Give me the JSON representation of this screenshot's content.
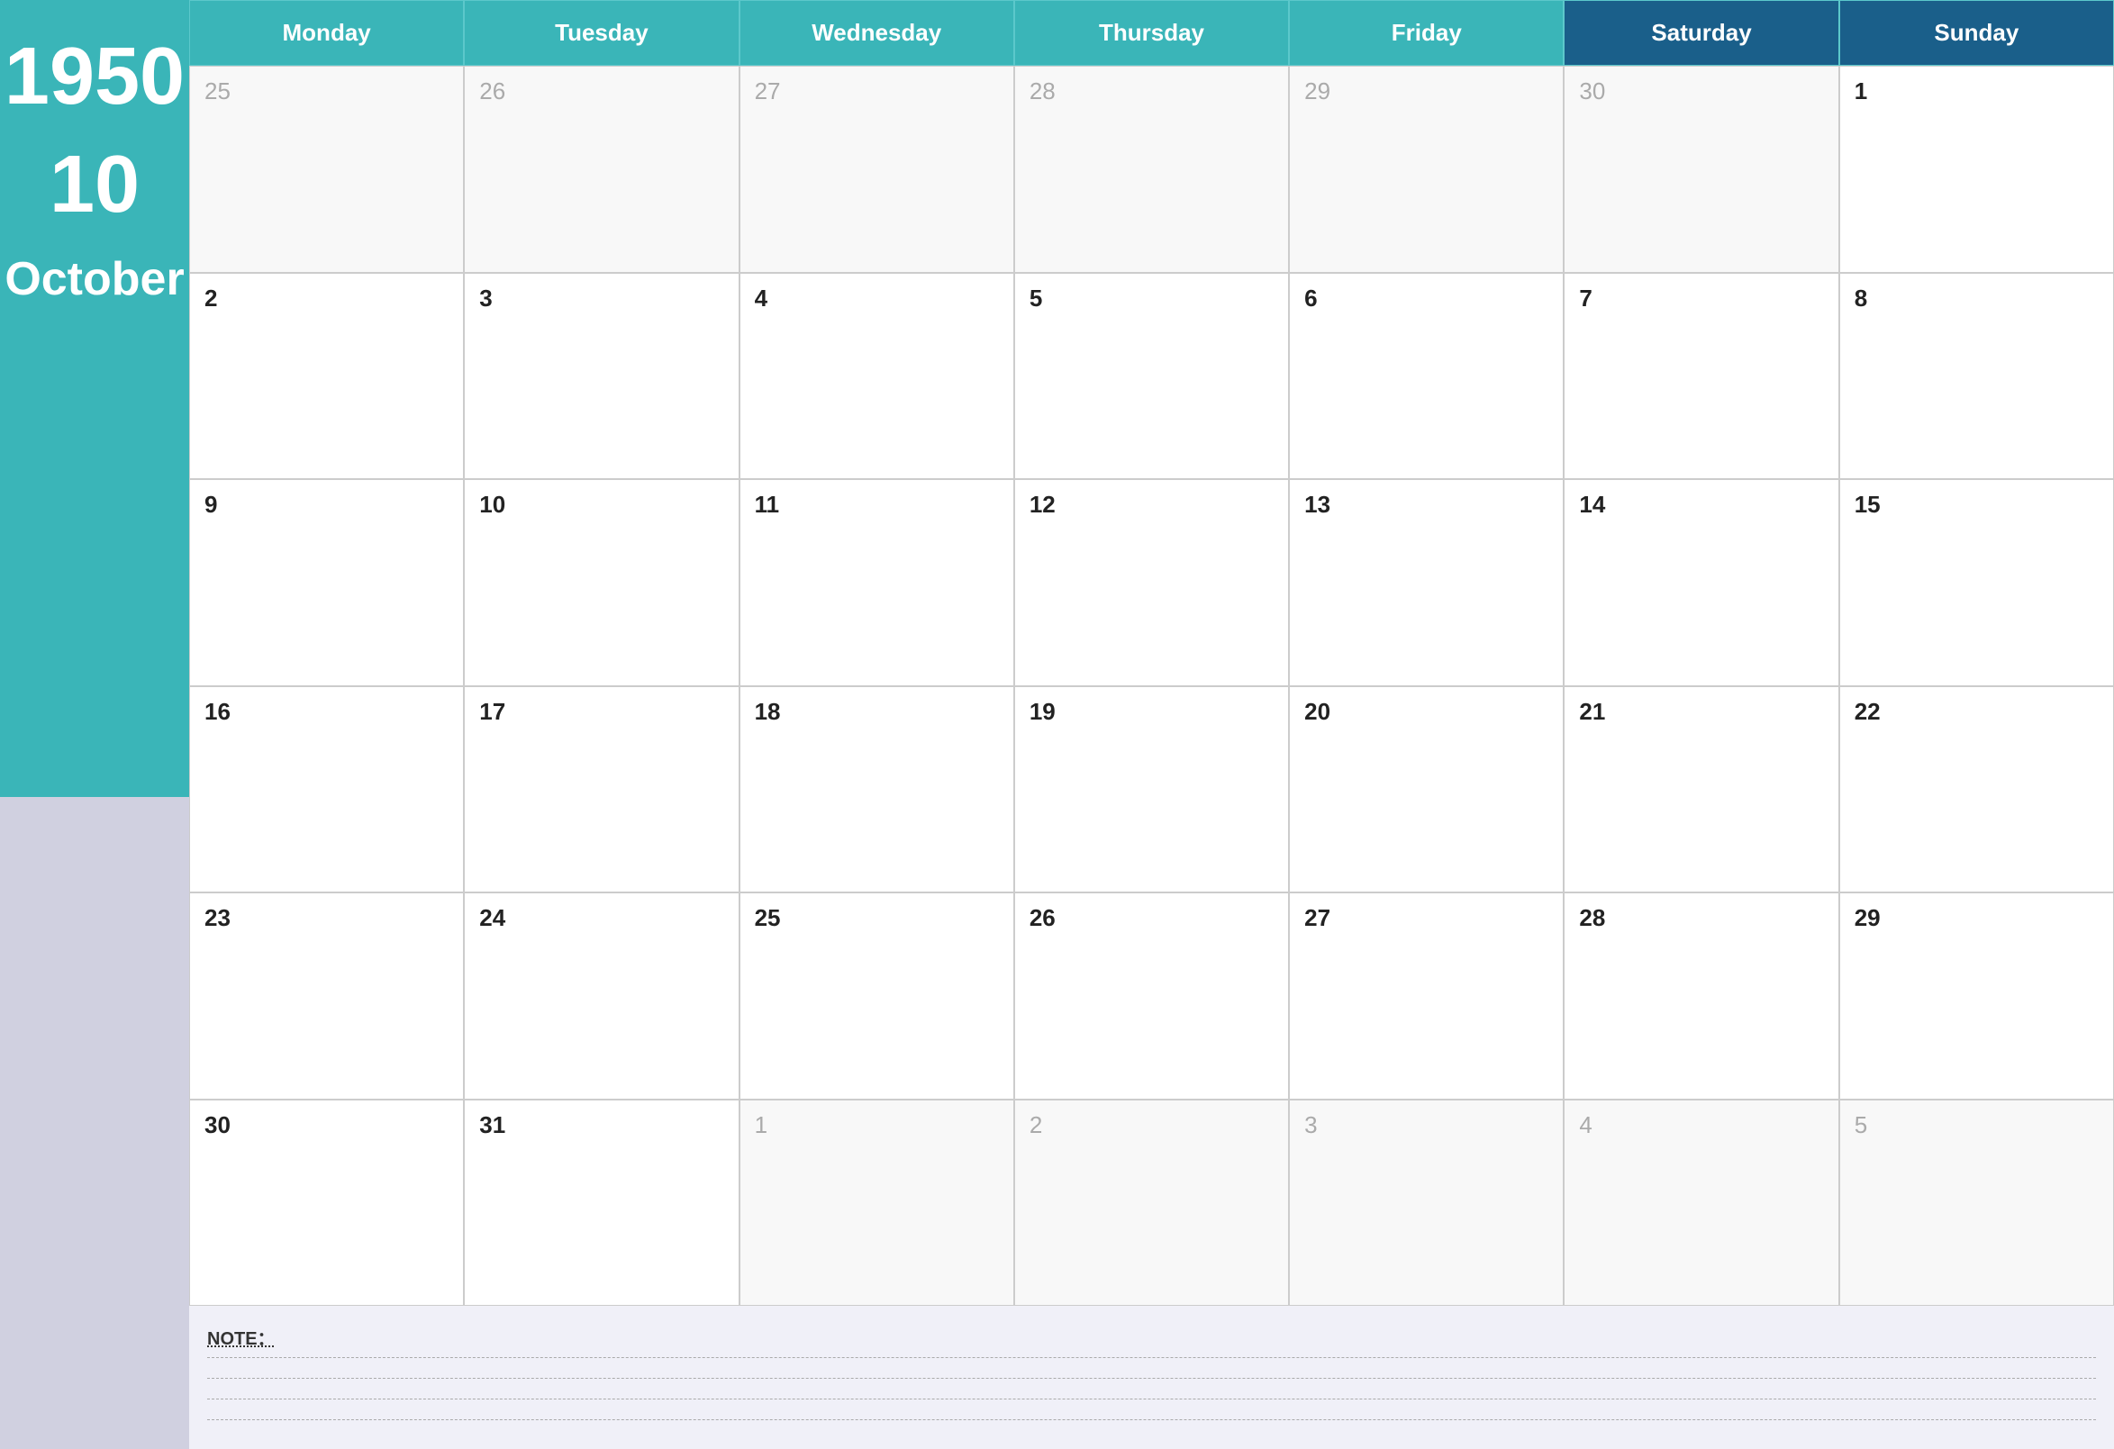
{
  "sidebar": {
    "year": "1950",
    "month_number": "10",
    "month_name": "October"
  },
  "header": {
    "days": [
      {
        "label": "Monday",
        "type": "weekday"
      },
      {
        "label": "Tuesday",
        "type": "weekday"
      },
      {
        "label": "Wednesday",
        "type": "weekday"
      },
      {
        "label": "Thursday",
        "type": "weekday"
      },
      {
        "label": "Friday",
        "type": "weekday"
      },
      {
        "label": "Saturday",
        "type": "weekend"
      },
      {
        "label": "Sunday",
        "type": "weekend"
      }
    ]
  },
  "weeks": [
    [
      {
        "number": "25",
        "outside": true
      },
      {
        "number": "26",
        "outside": true
      },
      {
        "number": "27",
        "outside": true
      },
      {
        "number": "28",
        "outside": true
      },
      {
        "number": "29",
        "outside": true
      },
      {
        "number": "30",
        "outside": true
      },
      {
        "number": "1",
        "outside": false
      }
    ],
    [
      {
        "number": "2",
        "outside": false
      },
      {
        "number": "3",
        "outside": false
      },
      {
        "number": "4",
        "outside": false
      },
      {
        "number": "5",
        "outside": false
      },
      {
        "number": "6",
        "outside": false
      },
      {
        "number": "7",
        "outside": false
      },
      {
        "number": "8",
        "outside": false
      }
    ],
    [
      {
        "number": "9",
        "outside": false
      },
      {
        "number": "10",
        "outside": false
      },
      {
        "number": "11",
        "outside": false
      },
      {
        "number": "12",
        "outside": false
      },
      {
        "number": "13",
        "outside": false
      },
      {
        "number": "14",
        "outside": false
      },
      {
        "number": "15",
        "outside": false
      }
    ],
    [
      {
        "number": "16",
        "outside": false
      },
      {
        "number": "17",
        "outside": false
      },
      {
        "number": "18",
        "outside": false
      },
      {
        "number": "19",
        "outside": false
      },
      {
        "number": "20",
        "outside": false
      },
      {
        "number": "21",
        "outside": false
      },
      {
        "number": "22",
        "outside": false
      }
    ],
    [
      {
        "number": "23",
        "outside": false
      },
      {
        "number": "24",
        "outside": false
      },
      {
        "number": "25",
        "outside": false
      },
      {
        "number": "26",
        "outside": false
      },
      {
        "number": "27",
        "outside": false
      },
      {
        "number": "28",
        "outside": false
      },
      {
        "number": "29",
        "outside": false
      }
    ],
    [
      {
        "number": "30",
        "outside": false
      },
      {
        "number": "31",
        "outside": false
      },
      {
        "number": "1",
        "outside": true
      },
      {
        "number": "2",
        "outside": true
      },
      {
        "number": "3",
        "outside": true
      },
      {
        "number": "4",
        "outside": true
      },
      {
        "number": "5",
        "outside": true
      }
    ]
  ],
  "notes": {
    "label": "NOTE：",
    "lines": 4
  },
  "colors": {
    "teal": "#3ab5b8",
    "dark_blue": "#1a5f8a",
    "sidebar_bottom": "#d0d0e0",
    "background": "#f0f0f8"
  }
}
